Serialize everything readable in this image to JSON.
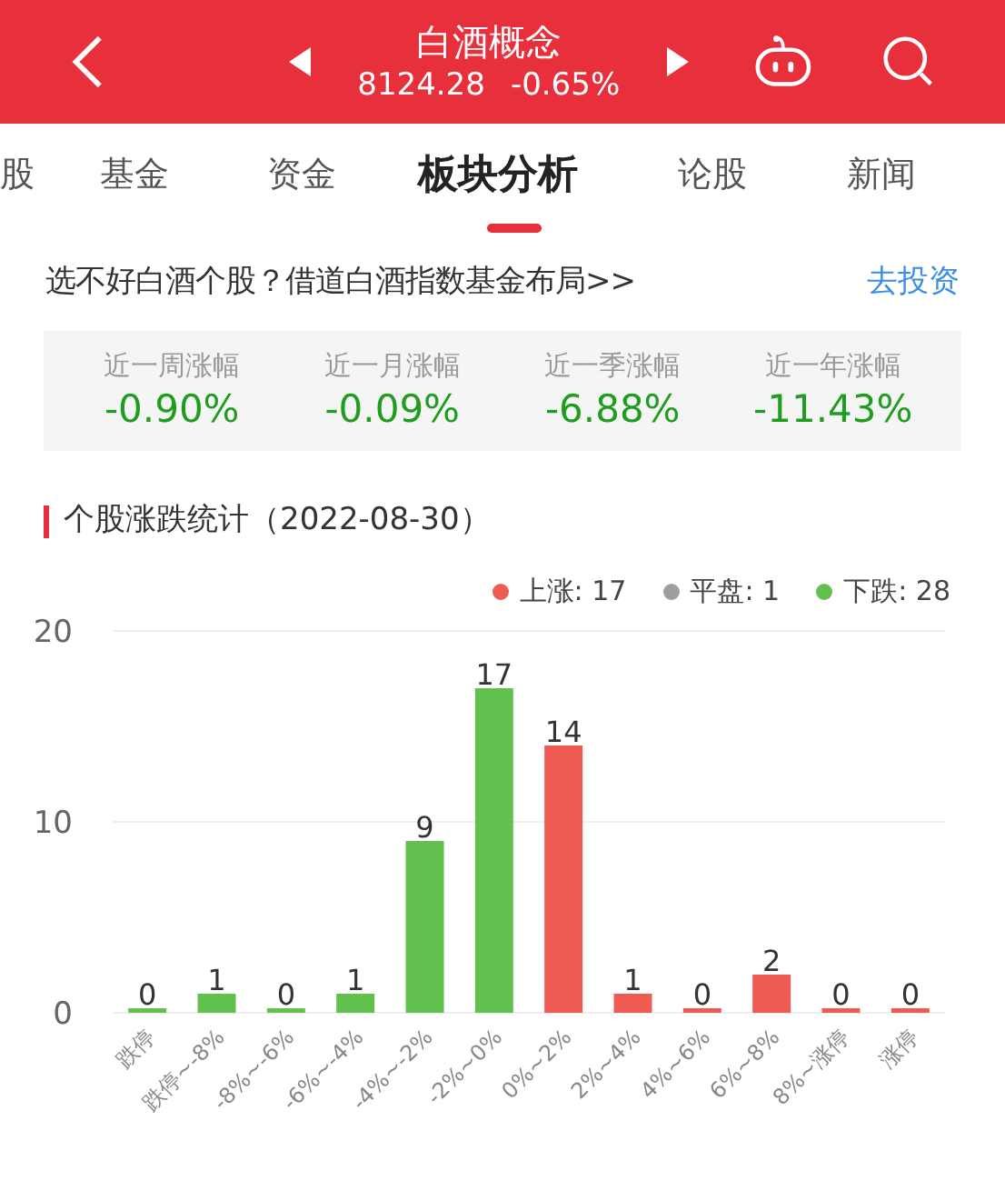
{
  "header": {
    "title": "白酒概念",
    "price": "8124.28",
    "change": "-0.65%"
  },
  "tabs": [
    {
      "label": "股",
      "selected": false
    },
    {
      "label": "基金",
      "selected": false
    },
    {
      "label": "资金",
      "selected": false
    },
    {
      "label": "板块分析",
      "selected": true
    },
    {
      "label": "论股",
      "selected": false
    },
    {
      "label": "新闻",
      "selected": false
    }
  ],
  "banner": {
    "text": "选不好白酒个股？借道白酒指数基金布局>>",
    "link": "去投资"
  },
  "stats": [
    {
      "label": "近一周涨幅",
      "value": "-0.90%"
    },
    {
      "label": "近一月涨幅",
      "value": "-0.09%"
    },
    {
      "label": "近一季涨幅",
      "value": "-6.88%"
    },
    {
      "label": "近一年涨幅",
      "value": "-11.43%"
    }
  ],
  "section": {
    "title": "个股涨跌统计（2022-08-30）"
  },
  "legend": [
    {
      "label": "上涨: 17",
      "color": "#ef5b52"
    },
    {
      "label": "平盘: 1",
      "color": "#9e9e9e"
    },
    {
      "label": "下跌: 28",
      "color": "#62c14e"
    }
  ],
  "chart_data": {
    "type": "bar",
    "stacked": true,
    "data_labels": true,
    "categories": [
      "跌停",
      "跌停~-8%",
      "-8%~-6%",
      "-6%~-4%",
      "-4%~-2%",
      "-2%~0%",
      "0%~2%",
      "2%~4%",
      "4%~6%",
      "6%~8%",
      "8%~涨停",
      "涨停"
    ],
    "series": [
      {
        "color": "#62c14e",
        "values": [
          0,
          1,
          0,
          1,
          9,
          17,
          null,
          null,
          null,
          null,
          null,
          null
        ]
      },
      {
        "color": "#ef5b52",
        "values": [
          null,
          null,
          null,
          null,
          null,
          null,
          14,
          1,
          0,
          2,
          0,
          0
        ]
      }
    ],
    "ylim": [
      0,
      20
    ],
    "yticks": [
      0,
      10,
      20
    ]
  }
}
